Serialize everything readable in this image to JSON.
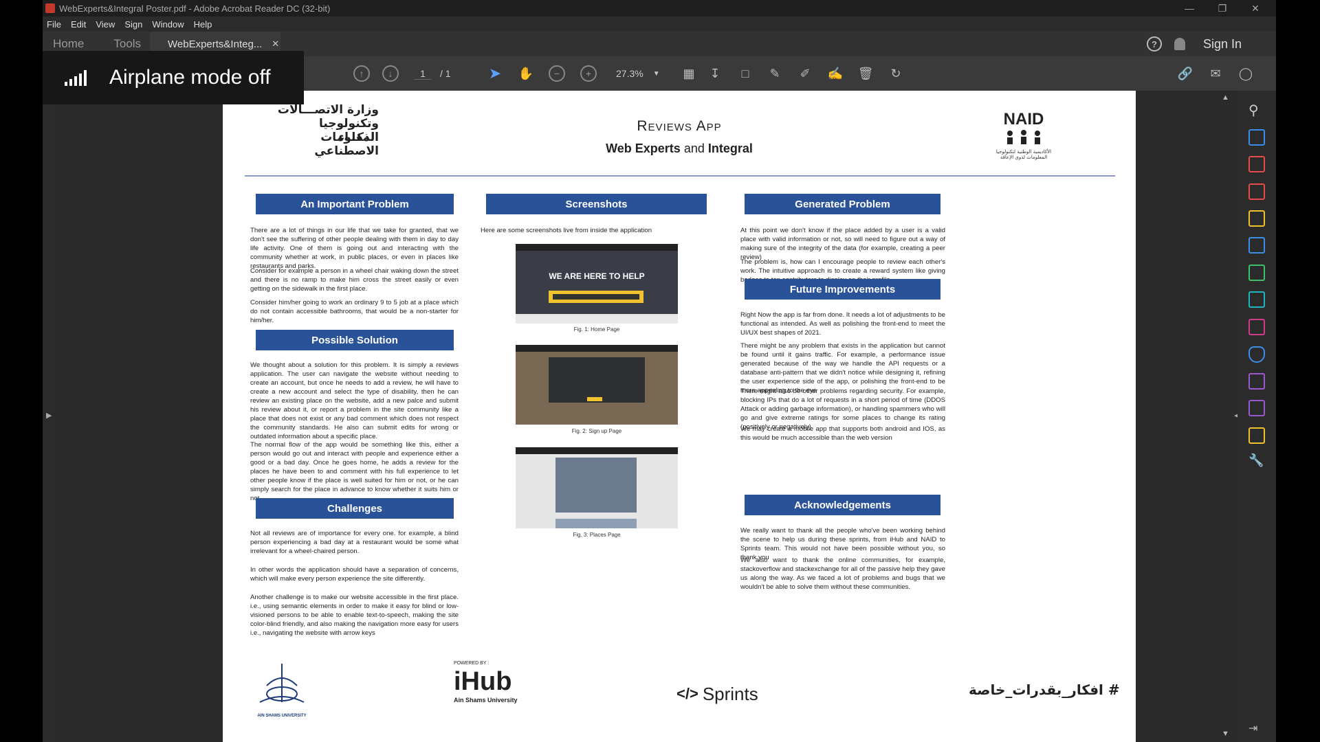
{
  "window": {
    "title": "WebExperts&Integral Poster.pdf - Adobe Acrobat Reader DC (32-bit)"
  },
  "menu": [
    "File",
    "Edit",
    "View",
    "Sign",
    "Window",
    "Help"
  ],
  "tabs": {
    "home": "Home",
    "tools": "Tools",
    "document": "WebExperts&Integ...",
    "sign_in": "Sign In"
  },
  "toolbar": {
    "page_current": "1",
    "page_total": "/ 1",
    "zoom": "27.3%"
  },
  "toast": {
    "text": "Airplane mode off"
  },
  "poster": {
    "title": "Reviews App",
    "subtitle_a": "Web Experts",
    "subtitle_and": "and",
    "subtitle_b": "Integral",
    "logo_ar_1": "وزارة الاتصـــالات",
    "logo_ar_2": "وتكنولوجيا المعلومات",
    "logo_ar_3": "الذكــاء الاصطناعي",
    "naid_logo": "NAID",
    "naid_sub": "الأكاديمية الوطنية لتكنولوجيا المعلومات لذوي الإعاقة",
    "sections": {
      "problem": "An Important Problem",
      "solution": "Possible Solution",
      "challenges": "Challenges",
      "screenshots": "Screenshots",
      "generated": "Generated Problem",
      "future": "Future Improvements",
      "ack": "Acknowledgements"
    },
    "problem_p1": "There are a lot of things in our life that we take for granted, that we don't see the suffering of other people dealing with them in day to day life activity. One of them is going out and interacting with the community whether at work, in public places, or even in places like restaurants and parks.",
    "problem_p2": "Consider for example a person in a wheel chair waking down the street and there is no ramp to make him cross the street easily or even getting on the sidewalk in the first place.",
    "problem_p3": "Consider him/her going to work an ordinary 9 to 5 job at a place which do not contain accessible bathrooms, that would be a non-starter for him/her.",
    "solution_p1": "We thought about a solution for this problem. It is simply a reviews application. The user can navigate the website without needing to create an account, but once he needs to add a review, he will have to create a new account and select the type of disability, then he can review an existing place on the website, add a new palce and submit his review about it, or report a problem in the site community like a place that does not exist or any bad comment which does not respect the community standards. He also can submit edits for wrong or outdated information about a specific place.",
    "solution_p2": "The normal flow of the app would be something like this, either a person would go out and interact with people and experience either a good or a bad day. Once he goes home, he adds a review for the places he have been to and comment with his full experience to let other people know if the place is well suited for him or not, or he can simply search for the place in advance to know whether it suits him or not.",
    "challenges_p1": "Not all reviews are of importance for every one. for example, a blind person experiencing a bad day at a restaurant would be some what irrelevant for a wheel-chaired person.",
    "challenges_p2": "In other words the application should have a separation of concerns, which will make every person experience the site differently.",
    "challenges_p3": "Another challenge is to make our website accessible in the first place. i.e., using semantic elements in order to make it easy for blind or low-visioned persons to be able to enable text-to-speech, making the site color-blind friendly, and also making the navigation more easy for users i.e., navigating the website with arrow keys",
    "screenshots_intro": "Here are some screenshots live from inside the application",
    "shot1_headline": "WE ARE HERE TO HELP",
    "fig1": "Fig. 1: Home Page",
    "fig2": "Fig. 2: Sign up Page",
    "fig3": "Fig. 3: Places Page",
    "generated_p1": "At this point we don't know if the place added by a user is a valid place with valid information or not, so will need to figure out a way of making sure of the integrity of the data (for example, creating a peer review)",
    "generated_p2": "The problem is, how can I encourage people to review each other's work. The intuitive approach is to create a reward system like giving badges to top contributors to display on their profile",
    "future_p1": "Right Now the app is far from done. It needs a lot of adjustments to be functional as intended. As well as polishing the front-end to meet the UI/UX best shapes of 2021.",
    "future_p2": "There might be any problem that exists in the application but cannot be found until it gains traffic. For example, a performance issue generated because of the way we handle the API requests or a database anti-pattern that we didn't notice while designing it, refining the user experience side of the app, or polishing the front-end to be more appealing to the eye",
    "future_p3": "There might also be other problems regarding security. For example, blocking IPs that do a lot of requests in a short period of time (DDOS Attack or adding garbage information), or handling spammers who will go and give extreme ratings for some places to change its rating (positively or negatively)",
    "future_p4": "We may create a mobile app that supports both android and IOS, as this would be much accessible than the web version",
    "ack_p1": "We really want to thank all the people who've been working behind the scene to help us during these sprints, from iHub and NAID to Sprints team. This would not have been possible without you, so thank you",
    "ack_p2": "We also want to thank the online communities, for example, stackoverflow and stackexchange for all of the passive help they gave us along the way. As we faced a lot of problems and bugs that we wouldn't be able to solve them without these communities.",
    "powered_by": "POWERED BY :",
    "ihub": "iHub",
    "ihub_sub": "Ain Shams University",
    "asu": "AIN SHAMS UNIVERSITY",
    "sprints": "Sprints",
    "hashtag": "# افكار_بقدرات_خاصة"
  }
}
